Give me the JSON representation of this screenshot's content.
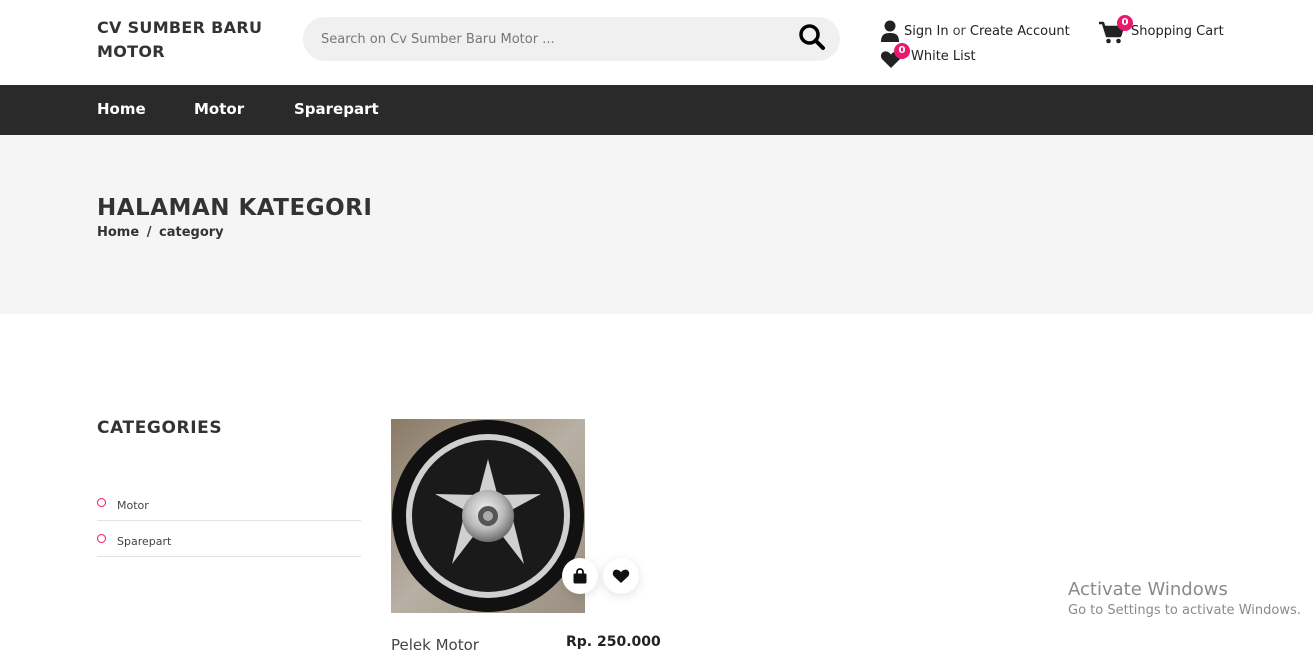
{
  "header": {
    "logo": "CV SUMBER BARU MOTOR",
    "search_placeholder": "Search on Cv Sumber Baru Motor ...",
    "sign_in": "Sign In",
    "or": "or",
    "create_account": "Create Account",
    "wishlist_label": "White List",
    "wishlist_count": "0",
    "cart_label": "Shopping Cart",
    "cart_count": "0"
  },
  "nav": {
    "items": [
      "Home",
      "Motor",
      "Sparepart"
    ]
  },
  "banner": {
    "title": "HALAMAN KATEGORI",
    "breadcrumb": [
      "Home",
      "/",
      "category"
    ]
  },
  "sidebar": {
    "title": "CATEGORIES",
    "items": [
      "Motor",
      "Sparepart"
    ]
  },
  "products": [
    {
      "name": "Pelek Motor",
      "price": "Rp. 250.000"
    }
  ],
  "overlay": {
    "line1": "Activate Windows",
    "line2": "Go to Settings to activate Windows."
  },
  "colors": {
    "accent": "#e8196e",
    "nav_bg": "#2a2a2a",
    "banner_bg": "#f5f5f5"
  }
}
